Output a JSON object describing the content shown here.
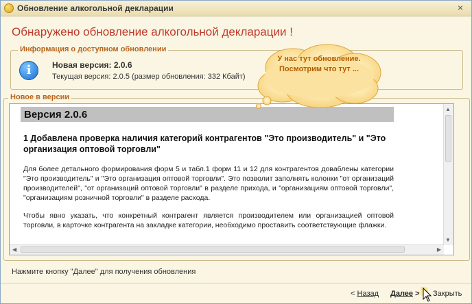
{
  "window": {
    "title": "Обновление алкогольной декларации",
    "close_glyph": "×"
  },
  "heading": "Обнаружено обновление алкогольной декларации !",
  "info_group": {
    "legend": "Информация о доступном обновлении",
    "icon": "info-icon",
    "new_version": "Новая версия: 2.0.6",
    "current_version": "Текущая версия: 2.0.5 (размер обновления: 332 Кбайт)"
  },
  "news_group": {
    "legend": "Новое в версии",
    "version_title": "Версия 2.0.6",
    "section_title": "1 Добавлена проверка наличия категорий контрагентов \"Это производитель\" и \"Это организация оптовой торговли\"",
    "paragraph1": "Для более детального формирования форм 5 и табл.1 форм 11 и 12 для контрагентов доваблены категории \"Это производитель\" и \"Это организация оптовой торговли\". Это позволит заполнять колонки \"от организаций производителей\", \"от организаций оптовой торговли\" в разделе прихода, и \"организациям оптовой торговли\", \"организациям розничной торговли\" в разделе расхода.",
    "paragraph2": "Чтобы явно указать, что конкретный контрагент является производителем или организацией оптовой торговли, в карточке контрагента на закладке категории, необходимо проставить соответствующие флажки."
  },
  "callout": {
    "text": "У нас тут обновление. Посмотрим что тут ..."
  },
  "hint": "Нажмите кнопку \"Далее\" для получения обновления",
  "buttons": {
    "back_glyph": "<",
    "back_label": "Назад",
    "next_label": "Далее",
    "next_glyph": ">",
    "close_label": "Закрыть"
  },
  "colors": {
    "heading": "#c0392b",
    "legend": "#b5651d",
    "callout_fill": "#fde9a8",
    "callout_text": "#b25c00"
  }
}
